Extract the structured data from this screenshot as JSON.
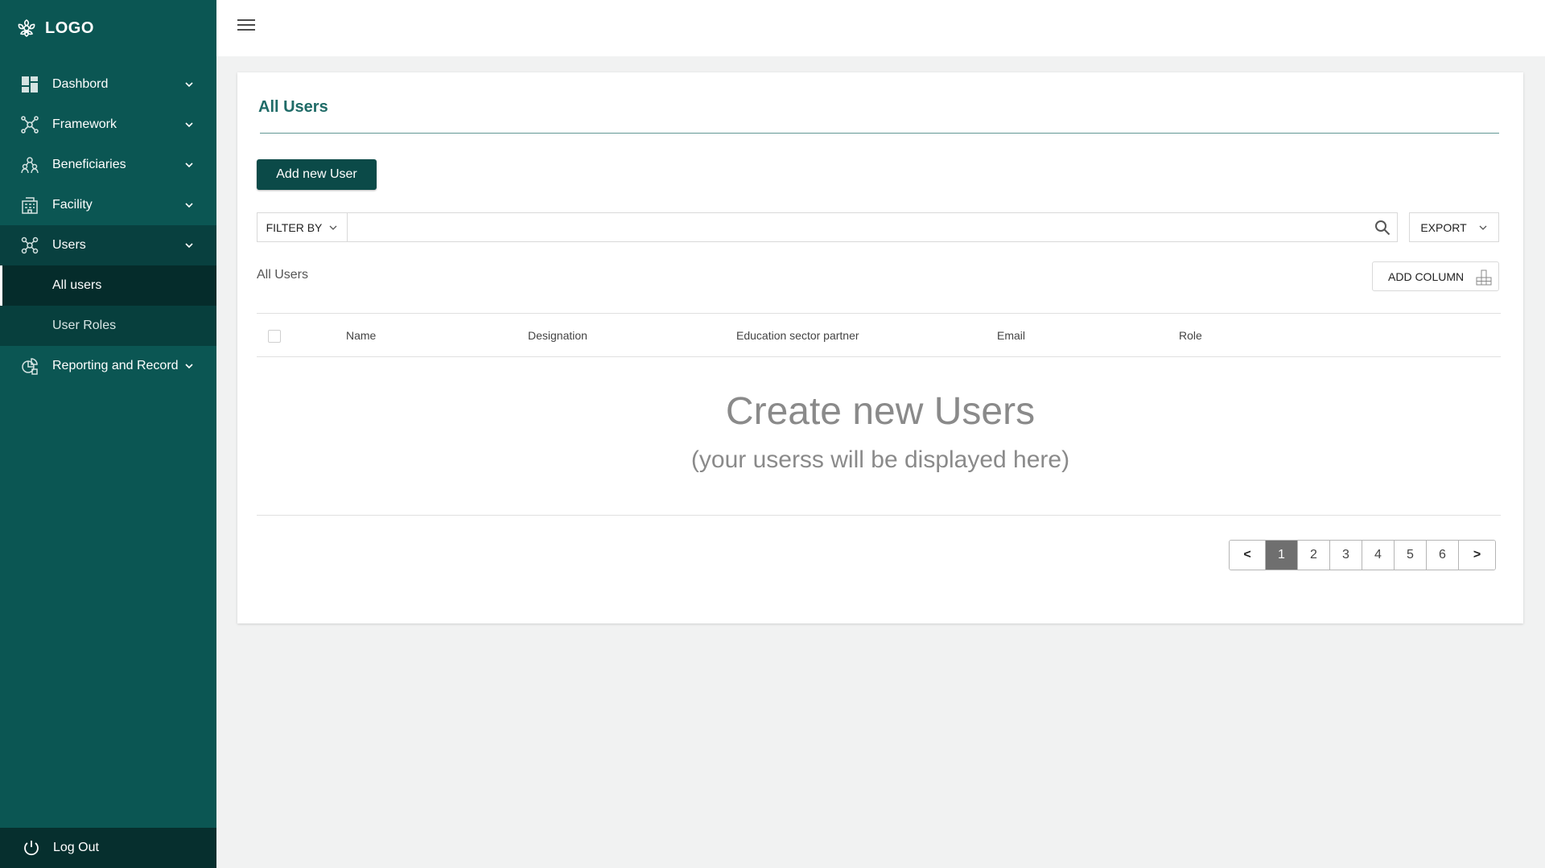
{
  "logo": {
    "text": "LOGO"
  },
  "sidebar": {
    "items": [
      {
        "label": "Dashbord"
      },
      {
        "label": "Framework"
      },
      {
        "label": "Beneficiaries"
      },
      {
        "label": "Facility"
      },
      {
        "label": "Users"
      },
      {
        "label": "Reporting and Record"
      }
    ],
    "users_sub": [
      {
        "label": "All users"
      },
      {
        "label": "User Roles"
      }
    ],
    "logout": "Log Out"
  },
  "main": {
    "title": "All Users",
    "add_button": "Add new User",
    "filter_label": "FILTER BY",
    "search": {
      "value": "",
      "placeholder": ""
    },
    "export_label": "EXPORT",
    "list_title": "All Users",
    "add_column_label": "ADD COLUMN",
    "columns": [
      "Name",
      "Designation",
      "Education sector partner",
      "Email",
      "Role"
    ],
    "empty_title": "Create new Users",
    "empty_subtitle": "(your userss will be displayed here)",
    "pagination": {
      "prev": "<",
      "pages": [
        "1",
        "2",
        "3",
        "4",
        "5",
        "6"
      ],
      "current": "1",
      "next": ">"
    }
  },
  "colors": {
    "sidebar": "#0b5653",
    "sidebar_active": "#052c2b",
    "accent": "#1f6b67",
    "button": "#0b4a48"
  }
}
